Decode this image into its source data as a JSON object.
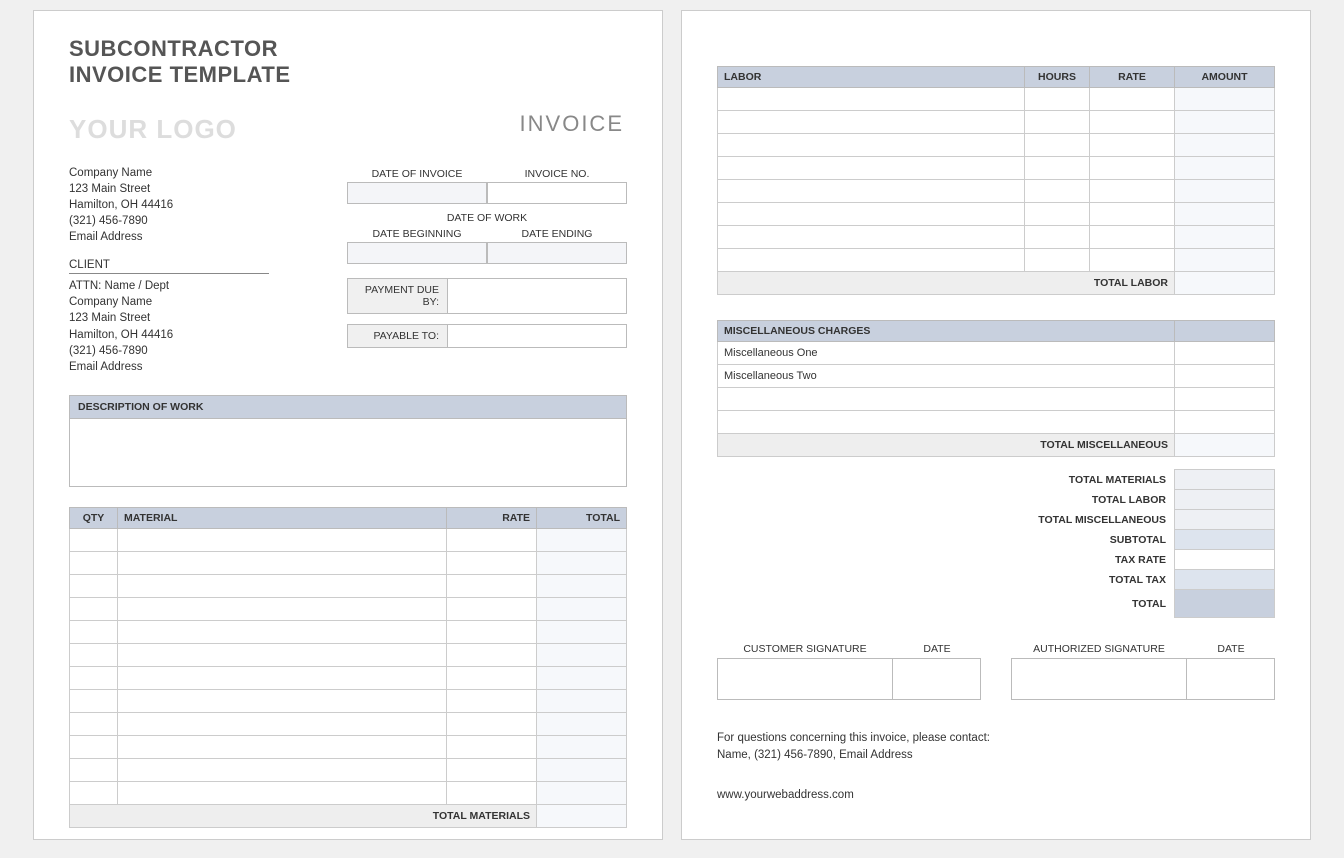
{
  "header": {
    "title_line1": "SUBCONTRACTOR",
    "title_line2": "INVOICE TEMPLATE",
    "logo": "YOUR LOGO",
    "invoice_word": "INVOICE"
  },
  "company": {
    "name": "Company Name",
    "street": "123 Main Street",
    "citystate": "Hamilton, OH  44416",
    "phone": "(321) 456-7890",
    "email": "Email Address"
  },
  "client": {
    "header": "CLIENT",
    "attn": "ATTN: Name / Dept",
    "name": "Company Name",
    "street": "123 Main Street",
    "citystate": "Hamilton, OH  44416",
    "phone": "(321) 456-7890",
    "email": "Email Address"
  },
  "meta": {
    "date_of_invoice_label": "DATE OF INVOICE",
    "invoice_no_label": "INVOICE NO.",
    "date_of_work_label": "DATE OF WORK",
    "date_beginning_label": "DATE BEGINNING",
    "date_ending_label": "DATE ENDING",
    "payment_due_label": "PAYMENT DUE BY:",
    "payable_to_label": "PAYABLE TO:"
  },
  "desc": {
    "header": "DESCRIPTION OF WORK"
  },
  "materials": {
    "headers": {
      "qty": "QTY",
      "material": "MATERIAL",
      "rate": "RATE",
      "total": "TOTAL"
    },
    "total_label": "TOTAL MATERIALS"
  },
  "labor": {
    "headers": {
      "labor": "LABOR",
      "hours": "HOURS",
      "rate": "RATE",
      "amount": "AMOUNT"
    },
    "total_label": "TOTAL LABOR"
  },
  "misc": {
    "header": "MISCELLANEOUS CHARGES",
    "rows": [
      "Miscellaneous One",
      "Miscellaneous Two",
      "",
      ""
    ],
    "total_label": "TOTAL MISCELLANEOUS"
  },
  "summary": {
    "total_materials": "TOTAL MATERIALS",
    "total_labor": "TOTAL LABOR",
    "total_misc": "TOTAL MISCELLANEOUS",
    "subtotal": "SUBTOTAL",
    "tax_rate": "TAX RATE",
    "total_tax": "TOTAL TAX",
    "total": "TOTAL"
  },
  "signatures": {
    "customer": "CUSTOMER SIGNATURE",
    "date": "DATE",
    "authorized": "AUTHORIZED SIGNATURE"
  },
  "footer": {
    "line1": "For questions concerning this invoice, please contact:",
    "line2": "Name, (321) 456-7890, Email Address",
    "web": "www.yourwebaddress.com"
  }
}
